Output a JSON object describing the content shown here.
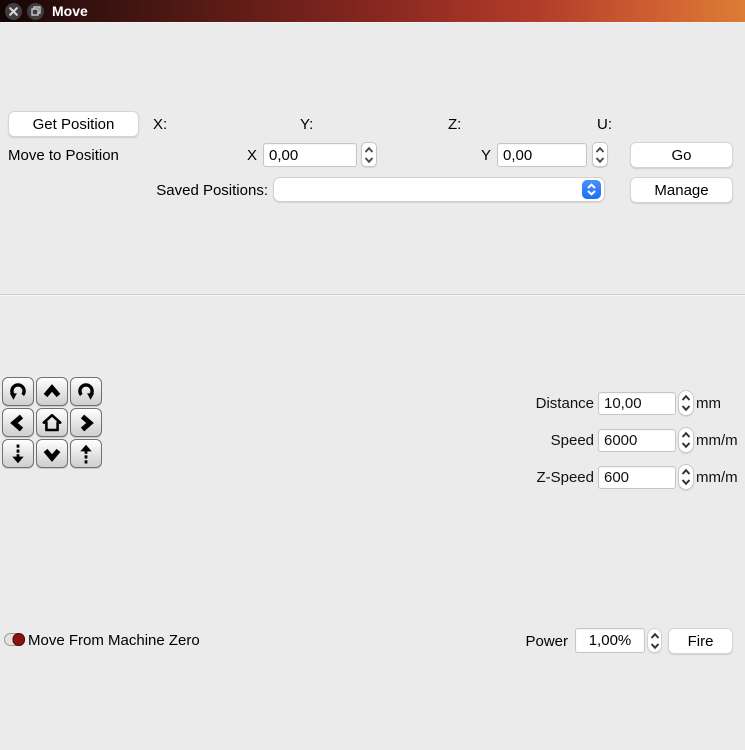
{
  "titlebar": {
    "title": "Move",
    "close_icon": "close-icon",
    "float_icon": "float-window-icon",
    "gradient_left": "#140404",
    "gradient_right": "#dc7d36"
  },
  "position_section": {
    "get_position_label": "Get Position",
    "axis_readouts": [
      {
        "label": "X:",
        "value": ""
      },
      {
        "label": "Y:",
        "value": ""
      },
      {
        "label": "Z:",
        "value": ""
      },
      {
        "label": "U:",
        "value": ""
      }
    ],
    "move_to_position_label": "Move to Position",
    "x_label": "X",
    "x_value": "0,00",
    "y_label": "Y",
    "y_value": "0,00",
    "go_label": "Go",
    "saved_positions_label": "Saved Positions:",
    "saved_positions_value": "",
    "manage_label": "Manage"
  },
  "jog": {
    "buttons": [
      "rotate-counterclockwise-icon",
      "jog-up-icon",
      "rotate-clockwise-icon",
      "jog-left-icon",
      "home-icon",
      "jog-right-icon",
      "z-down-icon",
      "jog-down-icon",
      "z-up-icon"
    ]
  },
  "jog_settings": {
    "rows": [
      {
        "label": "Distance",
        "value": "10,00",
        "unit": "mm"
      },
      {
        "label": "Speed",
        "value": "6000",
        "unit": "mm/m"
      },
      {
        "label": "Z-Speed",
        "value": "600",
        "unit": "mm/m"
      }
    ]
  },
  "bottom": {
    "move_from_machine_zero_label": "Move From Machine Zero",
    "power_label": "Power",
    "power_value": "1,00%",
    "fire_label": "Fire"
  },
  "colors": {
    "background": "#ebebeb",
    "accent_blue": "#2e7ef7",
    "toggle_red": "#8c1211",
    "titlebar_dark": "#140404",
    "titlebar_orange": "#dc7d36"
  }
}
